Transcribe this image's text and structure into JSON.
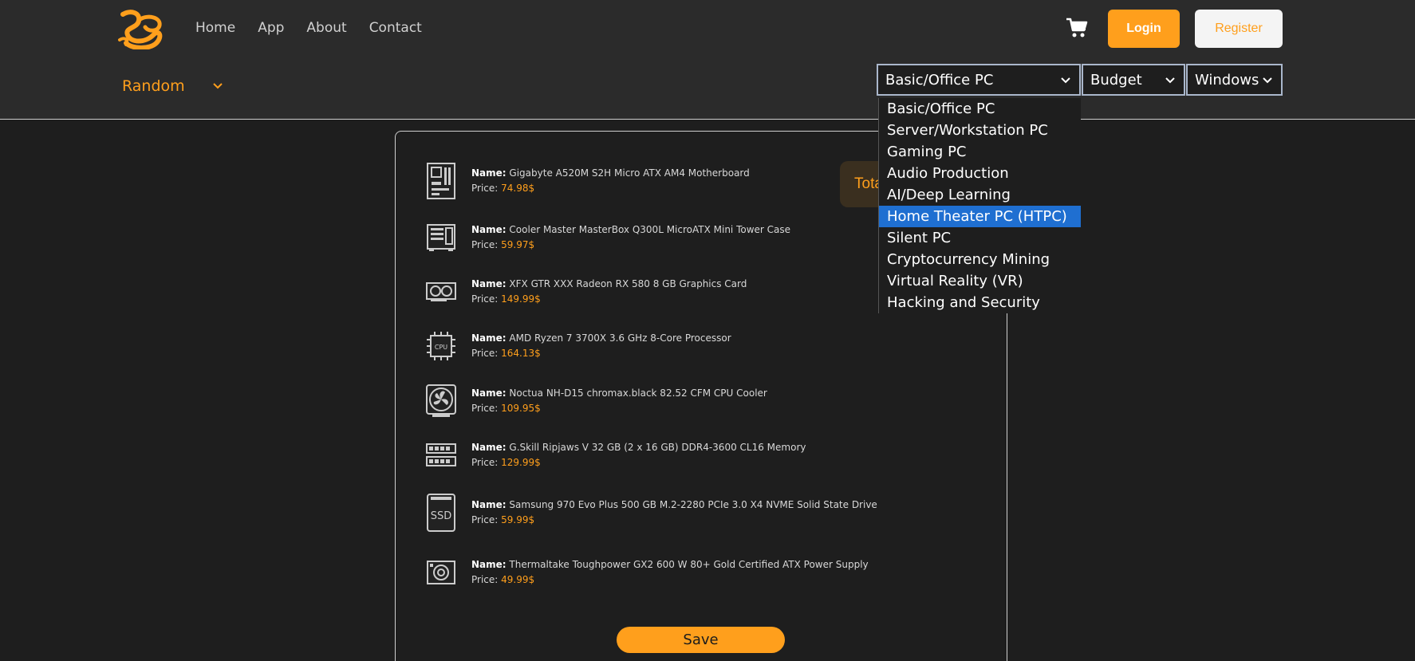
{
  "nav": {
    "items": [
      "Home",
      "App",
      "About",
      "Contact"
    ]
  },
  "header": {
    "login_label": "Login",
    "register_label": "Register"
  },
  "filter": {
    "random_label": "Random"
  },
  "selects": {
    "type": "Basic/Office PC",
    "budget": "Budget",
    "os": "Windows"
  },
  "dropdown": {
    "options": [
      "Basic/Office PC",
      "Server/Workstation PC",
      "Gaming PC",
      "Audio Production",
      "AI/Deep Learning",
      "Home Theater PC (HTPC)",
      "Silent PC",
      "Cryptocurrency Mining",
      "Virtual Reality (VR)",
      "Hacking and Security"
    ],
    "highlighted": "Home Theater PC (HTPC)"
  },
  "total": {
    "label": "Total"
  },
  "item_labels": {
    "name": "Name:",
    "price": "Price:"
  },
  "items": [
    {
      "icon": "motherboard-icon",
      "name": "Gigabyte A520M S2H Micro ATX AM4 Motherboard",
      "price": "74.98$"
    },
    {
      "icon": "case-icon",
      "name": "Cooler Master MasterBox Q300L MicroATX Mini Tower Case",
      "price": "59.97$"
    },
    {
      "icon": "graphics-card-icon",
      "name": "XFX GTR XXX Radeon RX 580 8 GB Graphics Card",
      "price": "149.99$"
    },
    {
      "icon": "cpu-icon",
      "name": "AMD Ryzen 7 3700X 3.6 GHz 8-Core Processor",
      "price": "164.13$"
    },
    {
      "icon": "cpu-cooler-icon",
      "name": "Noctua NH-D15 chromax.black 82.52 CFM CPU Cooler",
      "price": "109.95$"
    },
    {
      "icon": "memory-icon",
      "name": "G.Skill Ripjaws V 32 GB (2 x 16 GB) DDR4-3600 CL16 Memory",
      "price": "129.99$"
    },
    {
      "icon": "ssd-icon",
      "name": "Samsung 970 Evo Plus 500 GB M.2-2280 PCIe 3.0 X4 NVME Solid State Drive",
      "price": "59.99$"
    },
    {
      "icon": "power-supply-icon",
      "name": "Thermaltake Toughpower GX2 600 W 80+ Gold Certified ATX Power Supply",
      "price": "49.99$"
    }
  ],
  "save_label": "Save",
  "colors": {
    "accent": "#ff9f1c",
    "background": "#1e1e1e",
    "header": "#2b2b2b",
    "highlight": "#1f6fd1"
  }
}
